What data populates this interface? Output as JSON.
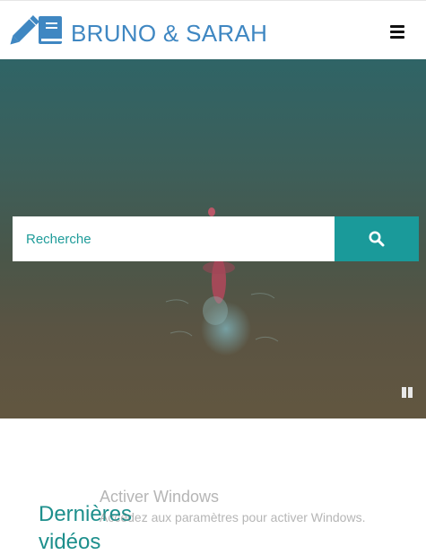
{
  "header": {
    "brand": "BRUNO & SARAH",
    "logo_icon": "pencil-book-icon",
    "menu_icon": "hamburger-menu-icon",
    "brand_color": "#3f87c2"
  },
  "hero": {
    "search": {
      "placeholder": "Recherche",
      "button_icon": "search-icon",
      "button_color": "#1a9a9a"
    },
    "pause_icon": "pause-icon"
  },
  "latest_videos": {
    "title": "Dernières vidéos",
    "title_color": "#1d8f8c"
  },
  "windows_watermark": {
    "title": "Activer Windows",
    "subtitle": "Accédez aux paramètres pour activer Windows."
  }
}
